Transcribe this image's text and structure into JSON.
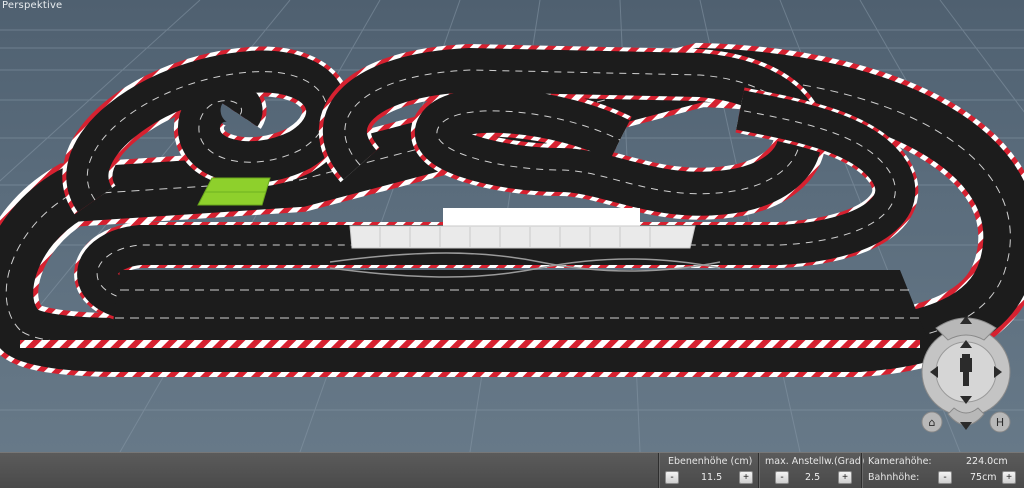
{
  "viewport": {
    "label": "Perspektive"
  },
  "navigation": {
    "home_glyph": "⌂",
    "h_label": "H"
  },
  "statusbar": {
    "level_height": {
      "label": "Ebenenhöhe (cm)",
      "value": "11.5",
      "minus": "-",
      "plus": "+"
    },
    "max_angle": {
      "label": "max. Anstellw.(Grad)",
      "value": "2.5",
      "minus": "-",
      "plus": "+"
    },
    "camera_height": {
      "label": "Kamerahöhe:",
      "value": "224.0cm"
    },
    "track_height": {
      "label": "Bahnhöhe:",
      "value": "75cm",
      "minus": "-",
      "plus": "+"
    }
  },
  "colors": {
    "track": "#1c1c1c",
    "curb_red": "#d62130",
    "curb_white": "#ffffff",
    "start_pad": "#8ed02c",
    "grid_bg": "#5a6c7c"
  },
  "icons": [
    "arrow-up-icon",
    "arrow-down-icon",
    "arrow-left-icon",
    "arrow-right-icon",
    "camera-icon",
    "home-icon",
    "h-icon"
  ]
}
